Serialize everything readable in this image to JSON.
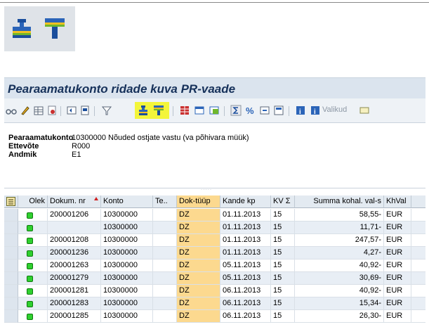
{
  "zoom_toolbar": {
    "icons": [
      "sum-icon",
      "subtotal-icon"
    ]
  },
  "title": "Pearaamatukonto ridade kuva PR-vaade",
  "toolbar": {
    "valikud_label": "Valikud",
    "highlight_color": "#f3f53a"
  },
  "header": {
    "rows": [
      {
        "label": "Pearaamatukonto",
        "value": "10300000 Nõuded ostjate vastu (va põhivara müük)"
      },
      {
        "label": "Ettevõte",
        "value": "R000"
      },
      {
        "label": "Andmik",
        "value": "E1"
      }
    ]
  },
  "table": {
    "columns": {
      "olek": "Olek",
      "dokum": "Dokum. nr",
      "konto": "Konto",
      "te": "Te..",
      "doktyyp": "Dok-tüüp",
      "kandekp": "Kande kp",
      "kv": "KV",
      "sum_sign": "Σ",
      "summa": "Summa kohal. val-s",
      "khval": "KhVal"
    },
    "rows": [
      {
        "dokum": "200001206",
        "konto": "10300000",
        "te": "",
        "doktyyp": "DZ",
        "kandekp": "01.11.2013",
        "kv": "15",
        "summa": "58,55-",
        "khval": "EUR"
      },
      {
        "dokum": "",
        "konto": "10300000",
        "te": "",
        "doktyyp": "DZ",
        "kandekp": "01.11.2013",
        "kv": "15",
        "summa": "11,71-",
        "khval": "EUR"
      },
      {
        "dokum": "200001208",
        "konto": "10300000",
        "te": "",
        "doktyyp": "DZ",
        "kandekp": "01.11.2013",
        "kv": "15",
        "summa": "247,57-",
        "khval": "EUR"
      },
      {
        "dokum": "200001236",
        "konto": "10300000",
        "te": "",
        "doktyyp": "DZ",
        "kandekp": "01.11.2013",
        "kv": "15",
        "summa": "4,27-",
        "khval": "EUR"
      },
      {
        "dokum": "200001263",
        "konto": "10300000",
        "te": "",
        "doktyyp": "DZ",
        "kandekp": "05.11.2013",
        "kv": "15",
        "summa": "40,92-",
        "khval": "EUR"
      },
      {
        "dokum": "200001279",
        "konto": "10300000",
        "te": "",
        "doktyyp": "DZ",
        "kandekp": "05.11.2013",
        "kv": "15",
        "summa": "30,69-",
        "khval": "EUR"
      },
      {
        "dokum": "200001281",
        "konto": "10300000",
        "te": "",
        "doktyyp": "DZ",
        "kandekp": "06.11.2013",
        "kv": "15",
        "summa": "40,92-",
        "khval": "EUR"
      },
      {
        "dokum": "200001283",
        "konto": "10300000",
        "te": "",
        "doktyyp": "DZ",
        "kandekp": "06.11.2013",
        "kv": "15",
        "summa": "15,34-",
        "khval": "EUR"
      },
      {
        "dokum": "200001285",
        "konto": "10300000",
        "te": "",
        "doktyyp": "DZ",
        "kandekp": "06.11.2013",
        "kv": "15",
        "summa": "26,30-",
        "khval": "EUR"
      }
    ]
  },
  "colors": {
    "status_green": "#2fd02f",
    "doc_type_highlight": "#fcd98f",
    "title_color": "#16315a"
  }
}
